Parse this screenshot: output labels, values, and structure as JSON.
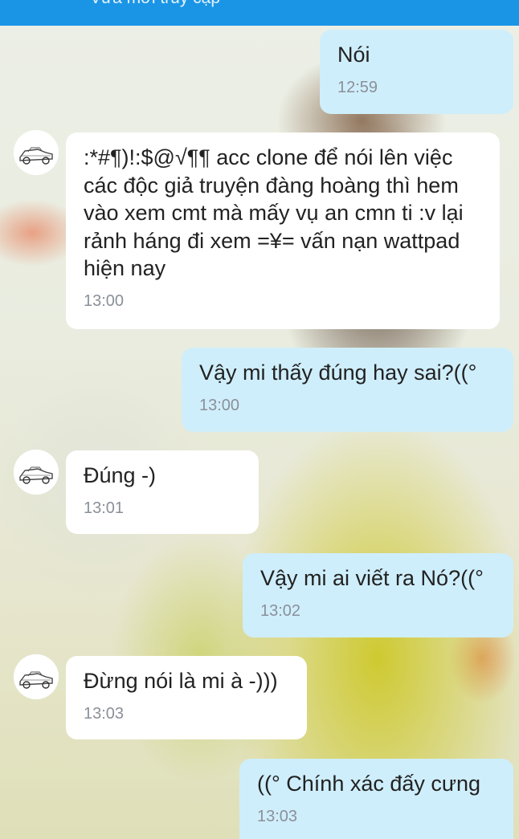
{
  "header": {
    "status": "Vừa mới truy cập"
  },
  "messages": [
    {
      "side": "out",
      "text": "Nói",
      "time": "12:59"
    },
    {
      "side": "in",
      "text": ":*#¶)!:$@√¶¶ acc clone để nói lên việc các độc giả truyện đàng hoàng thì hem vào xem cmt mà mấy vụ an cmn ti :v lại rảnh háng đi xem =¥= vấn nạn wattpad hiện nay",
      "time": "13:00"
    },
    {
      "side": "out",
      "text": "Vậy mi thấy đúng hay sai?((°",
      "time": "13:00"
    },
    {
      "side": "in",
      "text": "Đúng -)",
      "time": "13:01"
    },
    {
      "side": "out",
      "text": "Vậy mi ai viết ra Nó?((°",
      "time": "13:02"
    },
    {
      "side": "in",
      "text": "Đừng nói là mi à -)))",
      "time": "13:03"
    },
    {
      "side": "out",
      "text": "((° Chính xác đấy cưng",
      "time": "13:03"
    }
  ],
  "contact": {
    "avatar_icon": "car-sketch-avatar-icon"
  },
  "colors": {
    "header": "#1a95e6",
    "outgoing_bubble": "#cfeefb",
    "incoming_bubble": "#ffffff"
  }
}
